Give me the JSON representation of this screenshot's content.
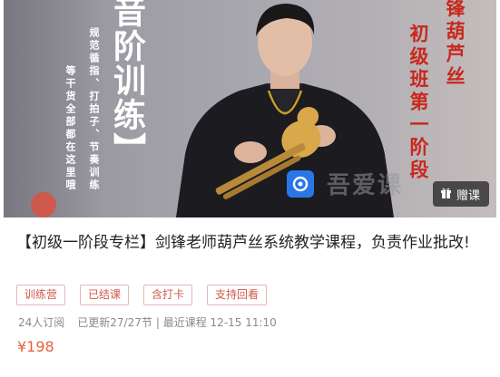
{
  "banner": {
    "title_vertical": "音阶训练",
    "bracket": "】",
    "sub_line_1": "规范循指、打拍子、节奏训练",
    "sub_line_2": "等干货全部都在这里哦",
    "red_line_1": "锋葫芦丝",
    "red_line_2": "初级班第一阶段",
    "watermark": "吾爱课",
    "gift_label": "赠课"
  },
  "course": {
    "title": "【初级一阶段专栏】剑锋老师葫芦丝系统教学课程，负责作业批改!",
    "tags": [
      "训练营",
      "已结课",
      "含打卡",
      "支持回看"
    ],
    "subscribers": "24人订阅",
    "updated": "已更新27/27节",
    "latest": "| 最近课程 12-15 11:10",
    "price": "¥198"
  },
  "colors": {
    "accent_red": "#c8281d",
    "tag_border": "#e4b8b3",
    "tag_text": "#d2584c",
    "price": "#e8603c",
    "brand_blue": "#2a76e6"
  }
}
